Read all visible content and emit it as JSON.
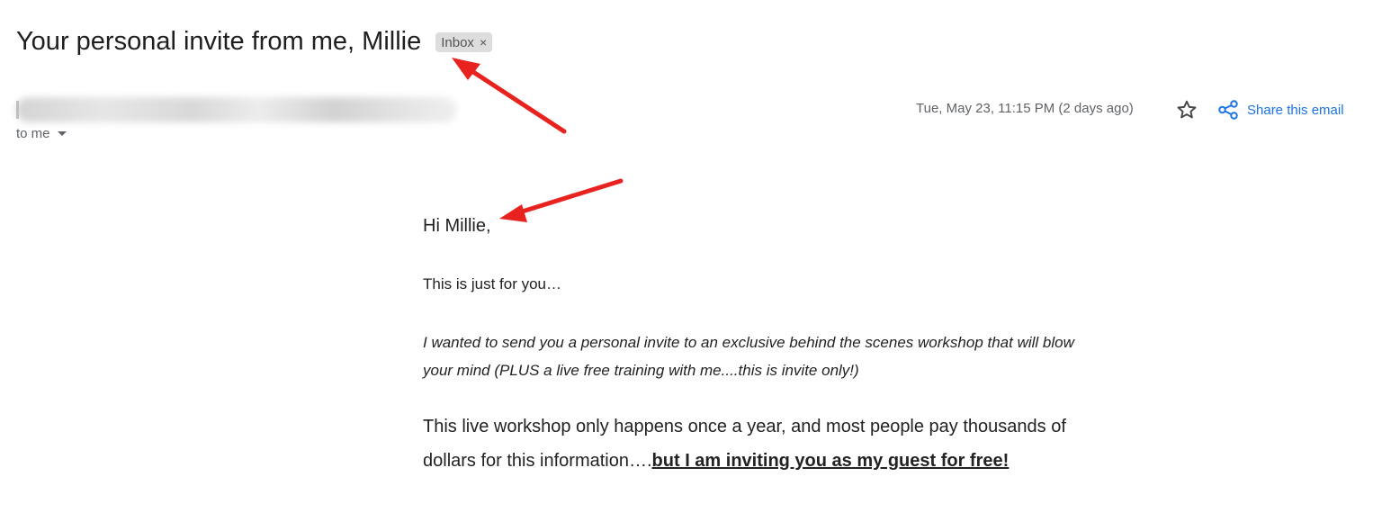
{
  "email": {
    "subject": "Your personal invite from me, Millie",
    "label": "Inbox",
    "label_remove_glyph": "×",
    "recipient": "to me",
    "date": "Tue, May 23, 11:15 PM (2 days ago)",
    "share_label": "Share this email"
  },
  "body": {
    "greeting": "Hi Millie,",
    "p1": "This is just for you…",
    "p2": "I wanted to send you a personal invite to an exclusive behind the scenes workshop that will blow your mind (PLUS a live free training with me....this is invite only!)",
    "p3_plain": "This live workshop only happens once a year, and most people pay thousands of dollars for this information….",
    "p3_emphasis": "but I am inviting you as my guest for free!"
  },
  "icons": {
    "star": "star-icon",
    "share": "share-icon",
    "caret": "caret-down-icon"
  },
  "colors": {
    "annotation_arrow": "#e8231f",
    "link_blue": "#1a73e8",
    "chip_bg": "#dddddd"
  }
}
